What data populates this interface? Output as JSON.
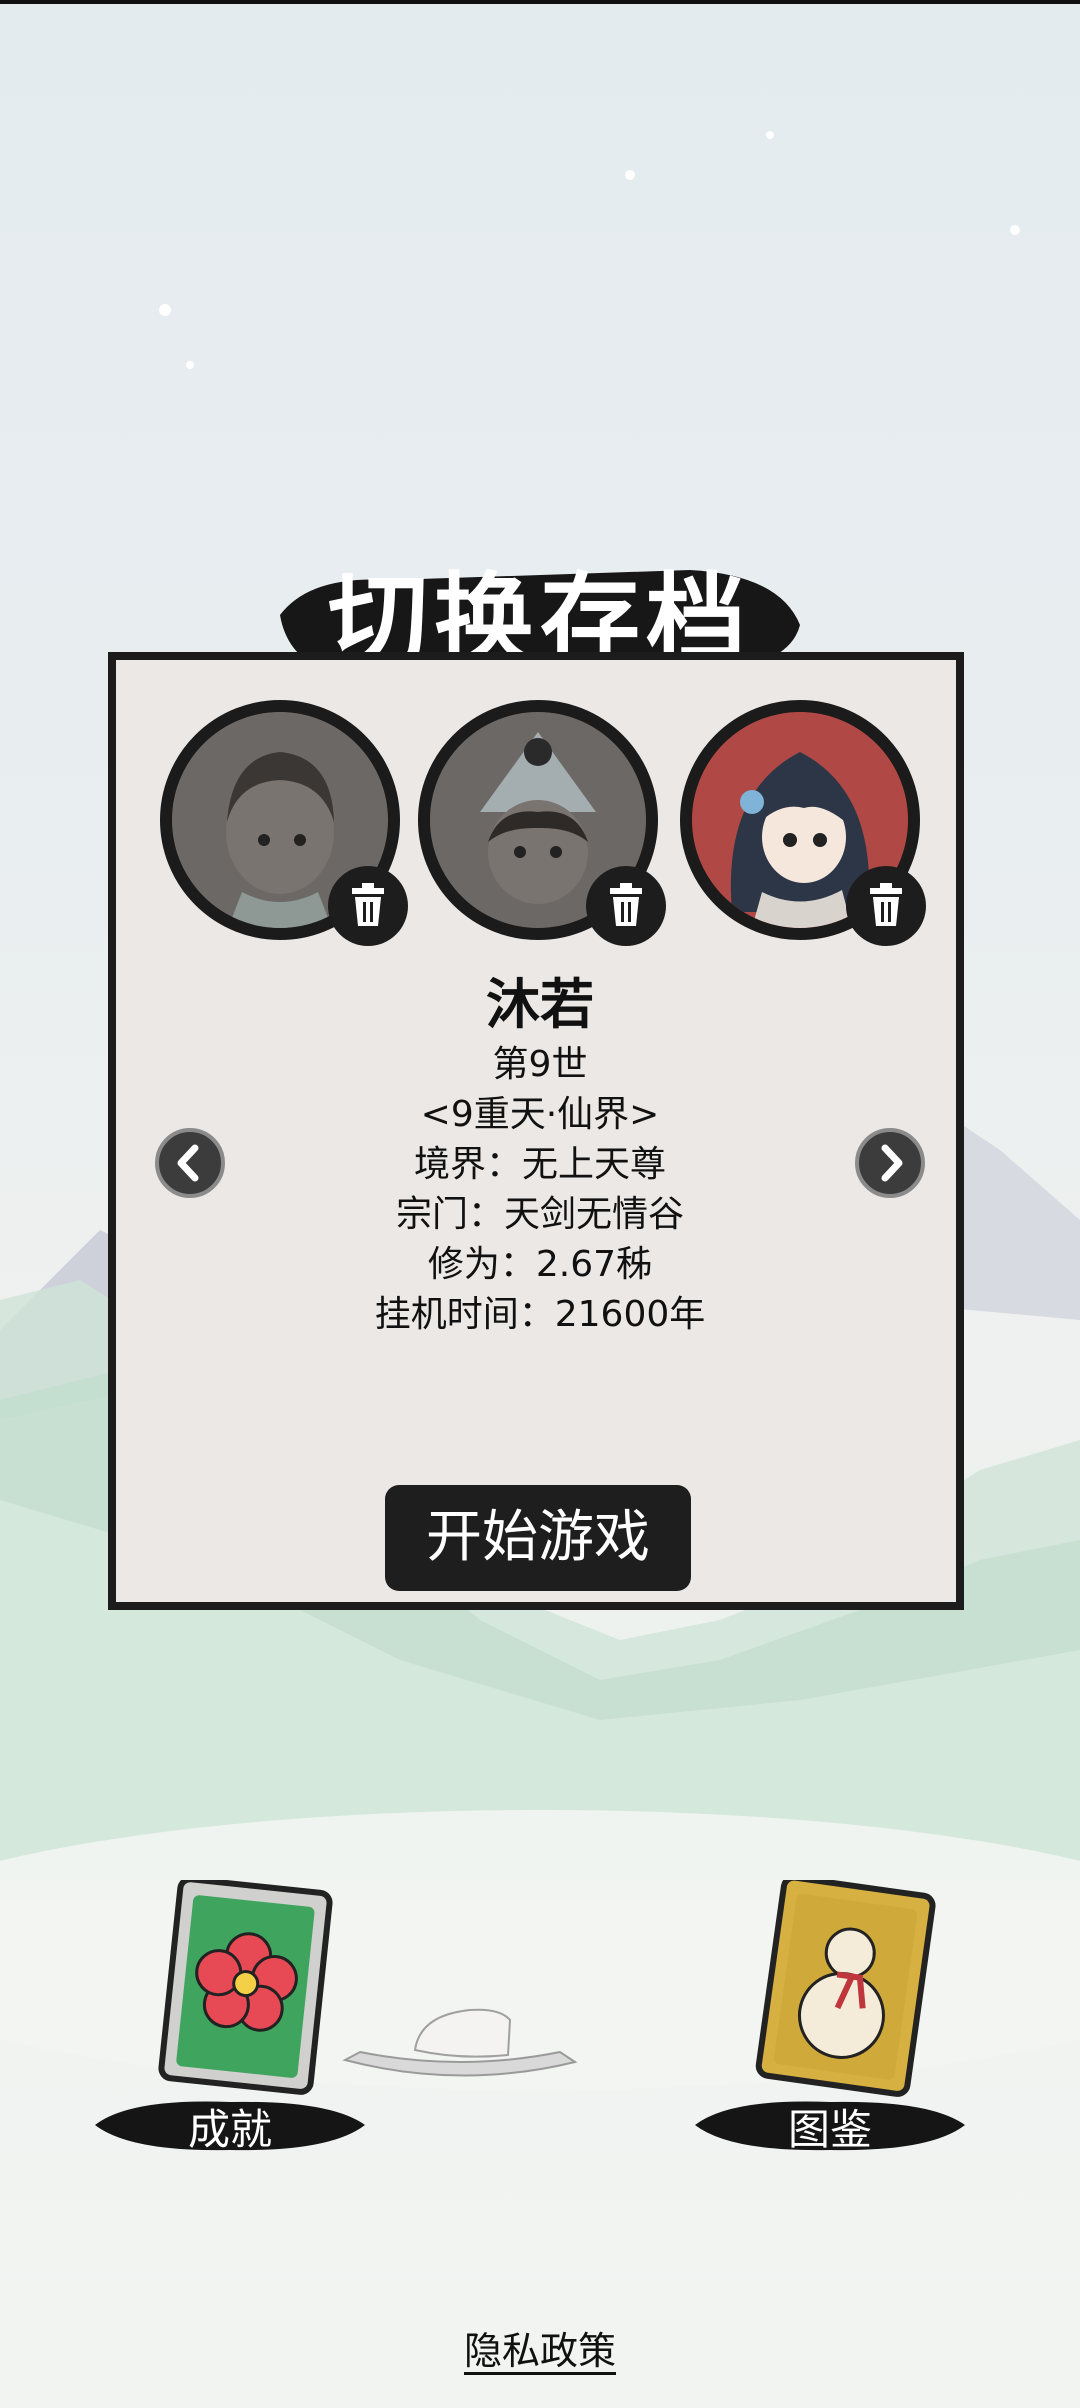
{
  "title": "切换存档",
  "save_slots": [
    {
      "character": "female-cultivator-avatar",
      "selected": false,
      "delete_icon": "trash-icon"
    },
    {
      "character": "hat-cultivator-avatar",
      "selected": false,
      "delete_icon": "trash-icon"
    },
    {
      "character": "girl-blue-hair-avatar",
      "selected": true,
      "delete_icon": "trash-icon"
    }
  ],
  "character": {
    "name": "沐若",
    "generation": "第9世",
    "realm_world": "<9重天·仙界>",
    "realm": "境界：无上天尊",
    "sect": "宗门：天剑无情谷",
    "cultivation": "修为：2.67秭",
    "idle_time": "挂机时间：21600年"
  },
  "nav": {
    "prev_icon": "chevron-left-icon",
    "next_icon": "chevron-right-icon"
  },
  "start_button": "开始游戏",
  "cards": {
    "achievements": {
      "label": "成就",
      "icon": "flower-card-icon"
    },
    "collection": {
      "label": "图鉴",
      "icon": "gourd-card-icon"
    }
  },
  "privacy_link": "隐私政策",
  "colors": {
    "panel": "#ebe8e6",
    "ink": "#1c1c1c",
    "selected_avatar": "#a03d3b"
  }
}
